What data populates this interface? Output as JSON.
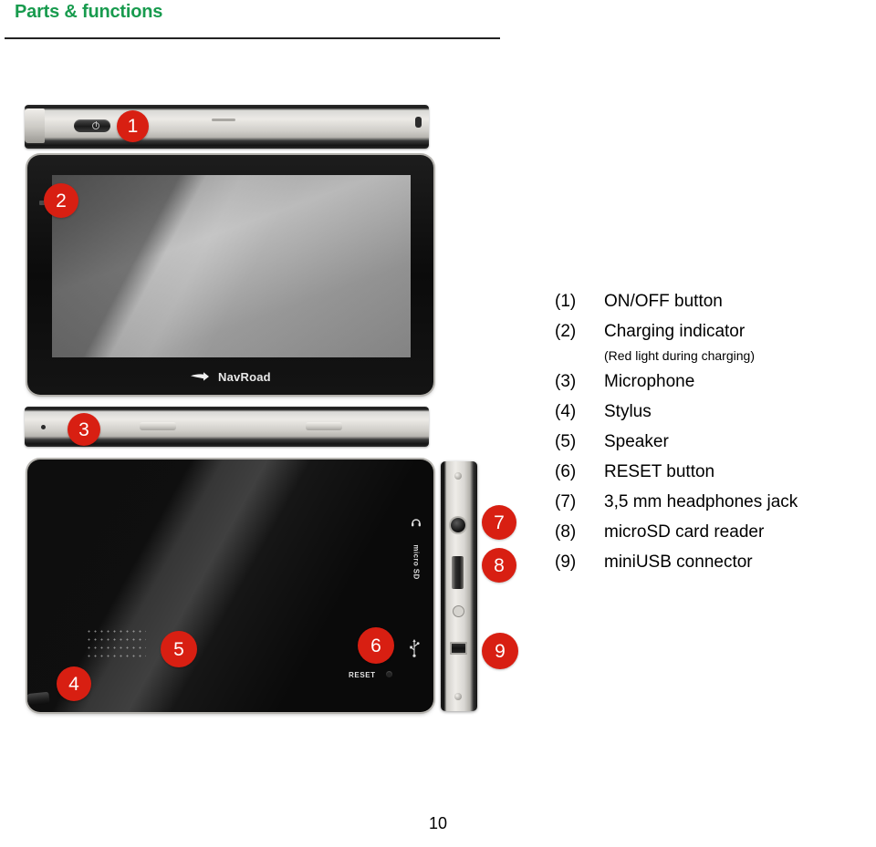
{
  "header": {
    "title": "Parts & functions",
    "title_color": "#189b4e",
    "rule_color": "#232323"
  },
  "device": {
    "brand_logo": "NavRoad",
    "logo_mark_icon": "navroad-swoosh-icon",
    "back_labels": {
      "reset": "RESET",
      "microsd": "micro SD"
    },
    "icons": {
      "power": "power-icon",
      "usb": "usb-icon",
      "headphone": "headphone-icon",
      "microphone": "microphone-hole-icon",
      "speaker": "speaker-grille-icon",
      "stylus": "stylus-icon",
      "reset_hole": "reset-pinhole-icon",
      "headphone_jack": "headphone-jack-port-icon",
      "microsd_slot": "microsd-slot-icon",
      "miniusb_port": "miniusb-port-icon"
    },
    "views": [
      {
        "name": "top-edge-view",
        "label": "Top edge with ON/OFF button"
      },
      {
        "name": "front-view",
        "label": "Front with screen and charging indicator"
      },
      {
        "name": "bottom-edge-view",
        "label": "Bottom edge with microphone"
      },
      {
        "name": "back-view",
        "label": "Back with stylus, speaker and RESET"
      },
      {
        "name": "side-edge-view",
        "label": "Side edge with jack, microSD and miniUSB"
      }
    ]
  },
  "callouts": [
    {
      "number": "1",
      "target": "ON/OFF button"
    },
    {
      "number": "2",
      "target": "Charging indicator"
    },
    {
      "number": "3",
      "target": "Microphone"
    },
    {
      "number": "4",
      "target": "Stylus"
    },
    {
      "number": "5",
      "target": "Speaker"
    },
    {
      "number": "6",
      "target": "RESET button"
    },
    {
      "number": "7",
      "target": "3,5 mm headphones jack"
    },
    {
      "number": "8",
      "target": "microSD card reader"
    },
    {
      "number": "9",
      "target": "miniUSB connector"
    }
  ],
  "callout_color": "#d81f12",
  "legend": [
    {
      "num": "(1)",
      "text": "ON/OFF button",
      "note": false
    },
    {
      "num": "(2)",
      "text": "Charging indicator",
      "note": false
    },
    {
      "num": "",
      "text": "(Red light during charging)",
      "note": true
    },
    {
      "num": "(3)",
      "text": "Microphone",
      "note": false
    },
    {
      "num": "(4)",
      "text": "Stylus",
      "note": false
    },
    {
      "num": "(5)",
      "text": "Speaker",
      "note": false
    },
    {
      "num": "(6)",
      "text": "RESET button",
      "note": false
    },
    {
      "num": "(7)",
      "text": "3,5 mm headphones jack",
      "note": false
    },
    {
      "num": "(8)",
      "text": "microSD card reader",
      "note": false
    },
    {
      "num": "(9)",
      "text": "miniUSB connector",
      "note": false
    }
  ],
  "footer": {
    "page_number": "10"
  }
}
